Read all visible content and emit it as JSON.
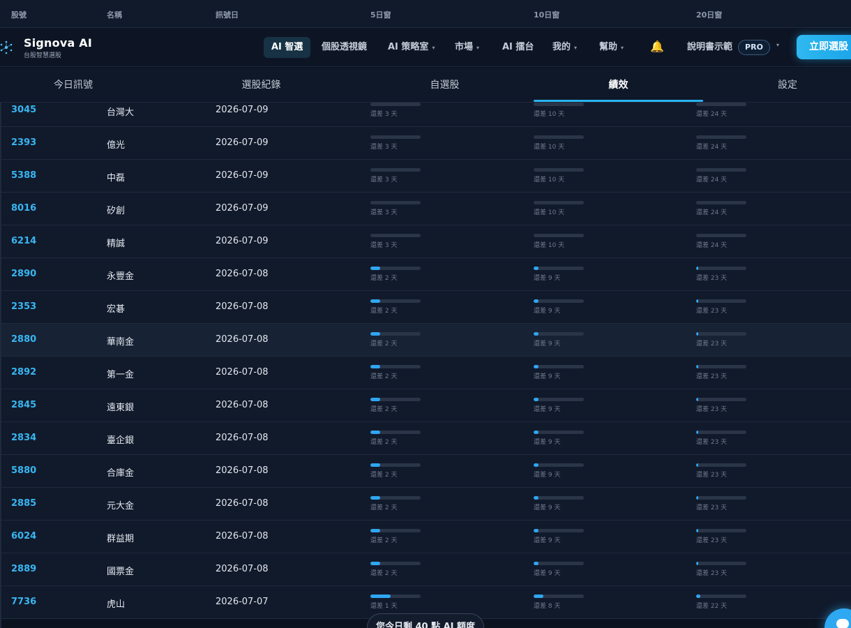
{
  "columns": {
    "code": "股號",
    "name": "名稱",
    "date": "訊號日",
    "w5": "5日窗",
    "w10": "10日窗",
    "w20": "20日窗"
  },
  "brand": {
    "name": "Signova AI",
    "subtitle": "台股智慧選股"
  },
  "nav": {
    "ai_select": "AI 智選",
    "stock_lens": "個股透視鏡",
    "strategy": "AI 策略室",
    "market": "市場",
    "arena": "AI 擂台",
    "mine": "我的",
    "help": "幫助",
    "demo": "說明書示範",
    "pro": "PRO",
    "cta": "立即選股"
  },
  "tabs": {
    "today": "今日訊號",
    "records": "選股紀錄",
    "watchlist": "自選股",
    "performance": "績效",
    "settings": "設定"
  },
  "rows": [
    {
      "code": "3045",
      "name": "台灣大",
      "date": "2026-07-09",
      "w5": {
        "label": "還差 3 天",
        "pct": 0
      },
      "w10": {
        "label": "還差 10 天",
        "pct": 0
      },
      "w20": {
        "label": "還差 24 天",
        "pct": 0
      }
    },
    {
      "code": "2393",
      "name": "億光",
      "date": "2026-07-09",
      "w5": {
        "label": "還差 3 天",
        "pct": 0
      },
      "w10": {
        "label": "還差 10 天",
        "pct": 0
      },
      "w20": {
        "label": "還差 24 天",
        "pct": 0
      }
    },
    {
      "code": "5388",
      "name": "中磊",
      "date": "2026-07-09",
      "w5": {
        "label": "還差 3 天",
        "pct": 0
      },
      "w10": {
        "label": "還差 10 天",
        "pct": 0
      },
      "w20": {
        "label": "還差 24 天",
        "pct": 0
      }
    },
    {
      "code": "8016",
      "name": "矽創",
      "date": "2026-07-09",
      "w5": {
        "label": "還差 3 天",
        "pct": 0
      },
      "w10": {
        "label": "還差 10 天",
        "pct": 0
      },
      "w20": {
        "label": "還差 24 天",
        "pct": 0
      }
    },
    {
      "code": "6214",
      "name": "精誠",
      "date": "2026-07-09",
      "w5": {
        "label": "還差 3 天",
        "pct": 0
      },
      "w10": {
        "label": "還差 10 天",
        "pct": 0
      },
      "w20": {
        "label": "還差 24 天",
        "pct": 0
      }
    },
    {
      "code": "2890",
      "name": "永豐金",
      "date": "2026-07-08",
      "w5": {
        "label": "還差 2 天",
        "pct": 20
      },
      "w10": {
        "label": "還差 9 天",
        "pct": 10
      },
      "w20": {
        "label": "還差 23 天",
        "pct": 4
      }
    },
    {
      "code": "2353",
      "name": "宏碁",
      "date": "2026-07-08",
      "w5": {
        "label": "還差 2 天",
        "pct": 20
      },
      "w10": {
        "label": "還差 9 天",
        "pct": 10
      },
      "w20": {
        "label": "還差 23 天",
        "pct": 4
      }
    },
    {
      "code": "2880",
      "name": "華南金",
      "date": "2026-07-08",
      "w5": {
        "label": "還差 2 天",
        "pct": 20
      },
      "w10": {
        "label": "還差 9 天",
        "pct": 10
      },
      "w20": {
        "label": "還差 23 天",
        "pct": 4
      }
    },
    {
      "code": "2892",
      "name": "第一金",
      "date": "2026-07-08",
      "w5": {
        "label": "還差 2 天",
        "pct": 20
      },
      "w10": {
        "label": "還差 9 天",
        "pct": 10
      },
      "w20": {
        "label": "還差 23 天",
        "pct": 4
      }
    },
    {
      "code": "2845",
      "name": "遠東銀",
      "date": "2026-07-08",
      "w5": {
        "label": "還差 2 天",
        "pct": 20
      },
      "w10": {
        "label": "還差 9 天",
        "pct": 10
      },
      "w20": {
        "label": "還差 23 天",
        "pct": 4
      }
    },
    {
      "code": "2834",
      "name": "臺企銀",
      "date": "2026-07-08",
      "w5": {
        "label": "還差 2 天",
        "pct": 20
      },
      "w10": {
        "label": "還差 9 天",
        "pct": 10
      },
      "w20": {
        "label": "還差 23 天",
        "pct": 4
      }
    },
    {
      "code": "5880",
      "name": "合庫金",
      "date": "2026-07-08",
      "w5": {
        "label": "還差 2 天",
        "pct": 20
      },
      "w10": {
        "label": "還差 9 天",
        "pct": 10
      },
      "w20": {
        "label": "還差 23 天",
        "pct": 4
      }
    },
    {
      "code": "2885",
      "name": "元大金",
      "date": "2026-07-08",
      "w5": {
        "label": "還差 2 天",
        "pct": 20
      },
      "w10": {
        "label": "還差 9 天",
        "pct": 10
      },
      "w20": {
        "label": "還差 23 天",
        "pct": 4
      }
    },
    {
      "code": "6024",
      "name": "群益期",
      "date": "2026-07-08",
      "w5": {
        "label": "還差 2 天",
        "pct": 20
      },
      "w10": {
        "label": "還差 9 天",
        "pct": 10
      },
      "w20": {
        "label": "還差 23 天",
        "pct": 4
      }
    },
    {
      "code": "2889",
      "name": "國票金",
      "date": "2026-07-08",
      "w5": {
        "label": "還差 2 天",
        "pct": 20
      },
      "w10": {
        "label": "還差 9 天",
        "pct": 10
      },
      "w20": {
        "label": "還差 23 天",
        "pct": 4
      }
    },
    {
      "code": "7736",
      "name": "虎山",
      "date": "2026-07-07",
      "w5": {
        "label": "還差 1 天",
        "pct": 40
      },
      "w10": {
        "label": "還差 8 天",
        "pct": 20
      },
      "w20": {
        "label": "還差 22 天",
        "pct": 9
      }
    }
  ],
  "toast": "您今日剩 40 點 AI 額度",
  "colors": {
    "accent": "#29b3f0",
    "code_text": "#38b6f2",
    "progress_fill": "#2fa6f2",
    "bell": "#f5b731"
  },
  "icons": {
    "logo": "network-dots-icon",
    "notifications": "bell-icon",
    "chat": "chat-bubble-icon"
  }
}
